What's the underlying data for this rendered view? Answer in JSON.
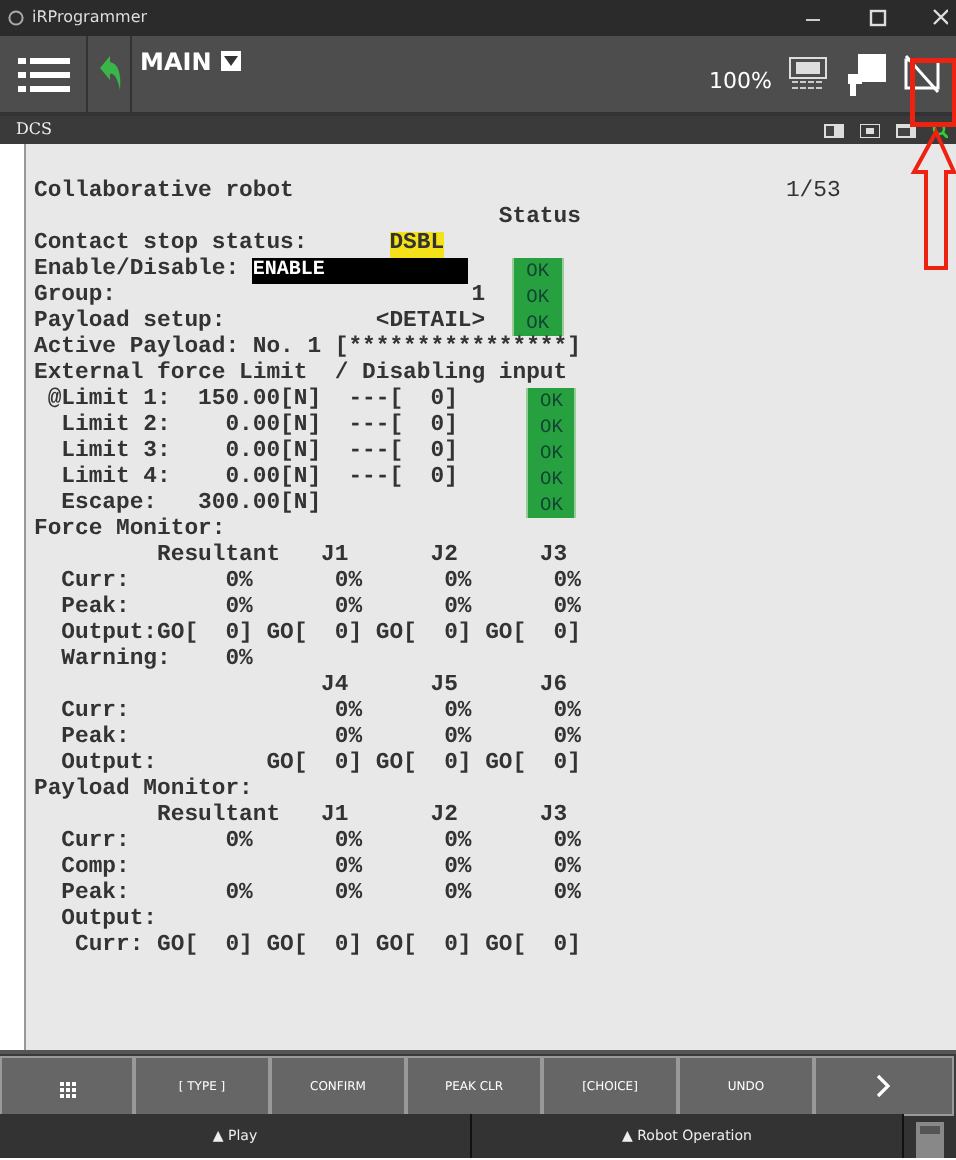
{
  "window": {
    "title": "iRProgrammer"
  },
  "toolbar": {
    "program": "MAIN",
    "override": "100%"
  },
  "panel": {
    "title": "DCS"
  },
  "screen": {
    "page": "1/53",
    "lines": [
      {
        "kind": "title",
        "text": "Collaborative robot"
      },
      {
        "kind": "text",
        "text": "                                  Status"
      },
      {
        "kind": "value",
        "label": "Contact stop status:",
        "value": "DSBL"
      },
      {
        "kind": "field",
        "label": "Enable/Disable:",
        "value": "ENABLE",
        "ok": "OK"
      },
      {
        "kind": "setting",
        "text": "Group:                          1",
        "ok": "OK"
      },
      {
        "kind": "setting",
        "text": "Payload setup:           <DETAIL>",
        "ok": "OK"
      },
      {
        "kind": "text",
        "text": "Active Payload: No. 1 [****************]"
      },
      {
        "kind": "text",
        "text": "External force Limit  / Disabling input"
      },
      {
        "kind": "limit",
        "text": " @Limit 1:  150.00[N]  ---[  0]",
        "ok": "OK"
      },
      {
        "kind": "limit",
        "text": "  Limit 2:    0.00[N]  ---[  0]",
        "ok": "OK"
      },
      {
        "kind": "limit",
        "text": "  Limit 3:    0.00[N]  ---[  0]",
        "ok": "OK"
      },
      {
        "kind": "limit",
        "text": "  Limit 4:    0.00[N]  ---[  0]",
        "ok": "OK"
      },
      {
        "kind": "limit",
        "text": "  Escape:   300.00[N]",
        "ok": "OK"
      },
      {
        "kind": "text",
        "text": "Force Monitor:"
      },
      {
        "kind": "text",
        "text": "         Resultant   J1      J2      J3"
      },
      {
        "kind": "text",
        "text": "  Curr:       0%      0%      0%      0%"
      },
      {
        "kind": "text",
        "text": "  Peak:       0%      0%      0%      0%"
      },
      {
        "kind": "text",
        "text": "  Output:GO[  0] GO[  0] GO[  0] GO[  0]"
      },
      {
        "kind": "text",
        "text": "  Warning:    0%"
      },
      {
        "kind": "text",
        "text": "                     J4      J5      J6"
      },
      {
        "kind": "text",
        "text": "  Curr:               0%      0%      0%"
      },
      {
        "kind": "text",
        "text": "  Peak:               0%      0%      0%"
      },
      {
        "kind": "text",
        "text": "  Output:        GO[  0] GO[  0] GO[  0]"
      },
      {
        "kind": "text",
        "text": "Payload Monitor:"
      },
      {
        "kind": "text",
        "text": "         Resultant   J1      J2      J3"
      },
      {
        "kind": "text",
        "text": "  Curr:       0%      0%      0%      0%"
      },
      {
        "kind": "text",
        "text": "  Comp:               0%      0%      0%"
      },
      {
        "kind": "text",
        "text": "  Peak:       0%      0%      0%      0%"
      },
      {
        "kind": "text",
        "text": "  Output:"
      },
      {
        "kind": "text",
        "text": "   Curr: GO[  0] GO[  0] GO[  0] GO[  0]"
      }
    ]
  },
  "function_keys": [
    "[ TYPE ]",
    "CONFIRM",
    "PEAK CLR",
    "[CHOICE]",
    "UNDO"
  ],
  "bottom_tabs": [
    "▲ Play",
    "▲ Robot Operation"
  ]
}
